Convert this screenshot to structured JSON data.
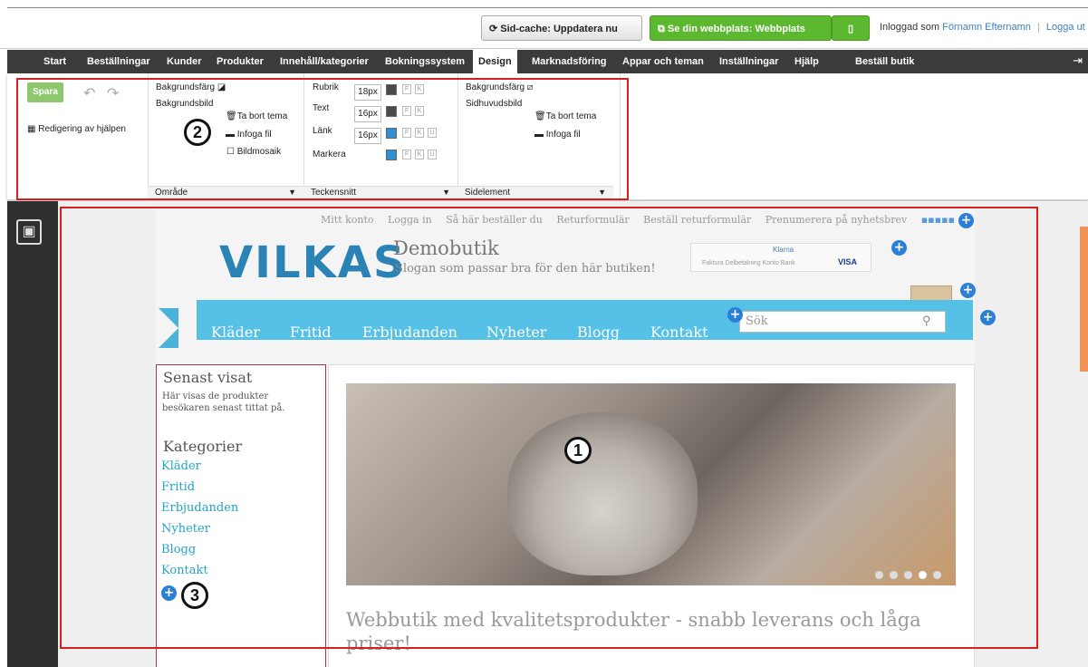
{
  "topbar": {
    "cache_button": "Sid-cache: Uppdatera nu",
    "site_button": "Se din webbplats: Webbplats",
    "logged_in_as": "Inloggad som",
    "user_name": "Förnamn Efternamn",
    "separator": "|",
    "logout": "Logga ut"
  },
  "nav": {
    "items": [
      "Start",
      "Beställningar",
      "Kunder",
      "Produkter",
      "Innehåll/kategorier",
      "Bokningssystem",
      "Design",
      "Marknadsföring",
      "Appar och teman",
      "Inställningar",
      "Hjälp",
      "Beställ butik"
    ],
    "active": "Design"
  },
  "ribbon": {
    "save": "Spara",
    "help_edit": "Redigering av hjälpen",
    "area": {
      "bg_color": "Bakgrundsfärg",
      "bg_image": "Bakgrundsbild",
      "remove_theme": "Ta bort tema",
      "insert_file": "Infoga fil",
      "mosaic": "Bildmosaik",
      "group": "Område"
    },
    "font": {
      "rows": [
        {
          "label": "Rubrik",
          "size": "18px",
          "color": "#4a4a4a"
        },
        {
          "label": "Text",
          "size": "16px",
          "color": "#4a4a4a"
        },
        {
          "label": "Länk",
          "size": "16px",
          "color": "#2f8fd6"
        },
        {
          "label": "Markera",
          "size": "",
          "color": "#2f8fd6"
        }
      ],
      "group": "Teckensnitt"
    },
    "side": {
      "bg_color": "Bakgrundsfärg",
      "header_image": "Sidhuvudsbild",
      "remove_theme": "Ta bort tema",
      "insert_file": "Infoga fil",
      "group": "Sidelement"
    }
  },
  "annotations": {
    "one": "1",
    "two": "2",
    "three": "3"
  },
  "shop": {
    "toplinks": [
      "Mitt konto",
      "Logga in",
      "Så här beställer du",
      "Returformulär",
      "Beställ returformulär",
      "Prenumerera på nyhetsbrev"
    ],
    "logo": "VILKAS",
    "name": "Demobutik",
    "slogan": "Slogan som passar bra för den här butiken!",
    "klarna": "Klarna",
    "klarna_methods": "Faktura  Delbetalning  Konto  Bank",
    "visa": "VISA",
    "menu": [
      "Kläder",
      "Fritid",
      "Erbjudanden",
      "Nyheter",
      "Blogg",
      "Kontakt"
    ],
    "search_placeholder": "Sök",
    "recent_title": "Senast visat",
    "recent_desc": "Här visas de produkter besökaren senast tittat på.",
    "categories_title": "Kategorier",
    "categories": [
      "Kläder",
      "Fritid",
      "Erbjudanden",
      "Nyheter",
      "Blogg",
      "Kontakt"
    ],
    "headline": "Webbutik med kvalitetsprodukter - snabb leverans och låga priser!"
  }
}
